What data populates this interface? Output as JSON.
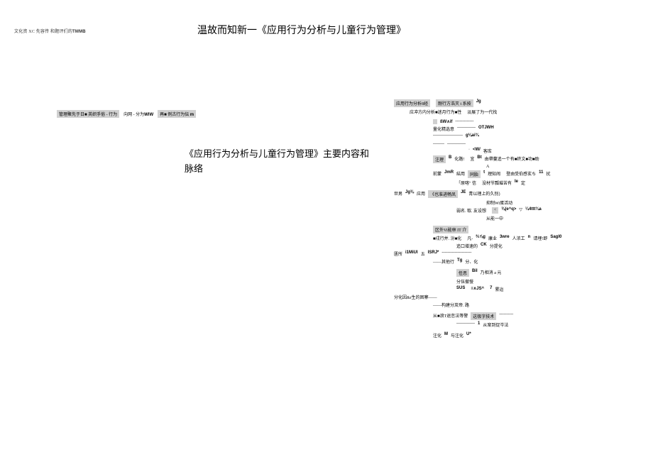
{
  "top_left_prefix": "文化资 XC 先容传 和题评们的",
  "top_left_bold": "TMMB",
  "main_title": "温故而知新一《应用行为分析与儿童行为管理》",
  "left_row": {
    "box1_a": "管理聚先于日",
    "box1_b": "■",
    "box1_c": " 英织手俗 - 行为",
    "mid": "向网 - 分为",
    "mid_bold": "WlW",
    "box2_a": "再",
    "box2_b": "■",
    "box2_c": " 例古行为伝",
    "box2_bold": "m"
  },
  "left_sub_title": "《应用行为分析与儿童行为管理》主要内容和脉络",
  "right": [
    {
      "cls": "r-line",
      "items": [
        {
          "t": "box",
          "v": "应用行为分析8经"
        },
        {
          "t": "plain",
          "v": "       "
        },
        {
          "t": "box",
          "v": "剛行方浩灭 t 系按"
        },
        {
          "t": "bold",
          "v": "Jg"
        }
      ]
    },
    {
      "cls": "r-line indent1",
      "items": [
        {
          "t": "plain",
          "v": "应冲方内分析■迷月行为■性"
        },
        {
          "t": "plain",
          "v": "                       "
        },
        {
          "t": "plain",
          "v": "淡展了为一代找"
        }
      ]
    },
    {
      "cls": "spacer"
    },
    {
      "cls": "r-line indent2",
      "items": [
        {
          "t": "box",
          "v": ""
        },
        {
          "t": "bold",
          "v": "ßW∧if"
        },
        {
          "t": "plain",
          "v": " -------------"
        }
      ]
    },
    {
      "cls": "r-line indent2",
      "items": [
        {
          "t": "plain",
          "v": "量化精选意"
        },
        {
          "t": "plain",
          "v": " -------------"
        },
        {
          "t": "bold",
          "v": "OTJWH"
        }
      ]
    },
    {
      "cls": "r-line indent2",
      "items": [
        {
          "t": "plain",
          "v": "---------------------"
        },
        {
          "t": "bold",
          "v": "g⅛ai¾"
        }
      ]
    },
    {
      "cls": "spacer"
    },
    {
      "cls": "r-line indent2",
      "items": [
        {
          "t": "plain",
          "v": "--------"
        },
        {
          "t": "plain",
          "v": "-------------"
        }
      ]
    },
    {
      "cls": "r-line indent4",
      "items": [
        {
          "t": "plain",
          "v": "·"
        },
        {
          "t": "bold",
          "v": "<W/"
        },
        {
          "t": "plain",
          "v": "客库"
        }
      ]
    },
    {
      "cls": "r-line indent2",
      "items": [
        {
          "t": "box",
          "v": "注理"
        },
        {
          "t": "bold",
          "v": "B"
        },
        {
          "t": "plain",
          "v": " 化路!"
        },
        {
          "t": "plain",
          "v": "           "
        },
        {
          "t": "plain",
          "v": "宜"
        },
        {
          "t": "bold",
          "v": "Bt"
        },
        {
          "t": "plain",
          "v": "由帶蔓追一个有■终文■功■助"
        }
      ]
    },
    {
      "cls": "r-line indent5",
      "items": [
        {
          "t": "plain",
          "v": "A"
        }
      ]
    },
    {
      "cls": "r-line indent2",
      "items": [
        {
          "t": "plain",
          "v": "前蒙"
        },
        {
          "t": "bold",
          "v": "JmR"
        },
        {
          "t": "plain",
          "v": " 結用"
        },
        {
          "t": "box",
          "v": "同胎"
        },
        {
          "t": "bold",
          "v": "t"
        },
        {
          "t": "plain",
          "v": " 理知闹"
        },
        {
          "t": "plain",
          "v": "        "
        },
        {
          "t": "plain",
          "v": "登由受伯感玄ち"
        },
        {
          "t": "bold",
          "v": "11"
        },
        {
          "t": "plain",
          "v": " 扰"
        }
      ]
    },
    {
      "cls": "r-line indent3",
      "items": [
        {
          "t": "plain",
          "v": "「原喀\" 信"
        },
        {
          "t": "plain",
          "v": "                "
        },
        {
          "t": "plain",
          "v": "没材节瓢璀苦有"
        },
        {
          "t": "bold",
          "v": "Ie"
        },
        {
          "t": "plain",
          "v": " 定"
        }
      ]
    },
    {
      "cls": "spacer"
    },
    {
      "cls": "r-line",
      "items": [
        {
          "t": "plain",
          "v": "世男"
        },
        {
          "t": "bold",
          "v": "Jg⅜"
        },
        {
          "t": "plain",
          "v": "应用"
        },
        {
          "t": "box",
          "v": "《也准进畅凤"
        },
        {
          "t": "bold",
          "v": "JE"
        },
        {
          "t": "plain",
          "v": " 青以理上的久别}"
        }
      ]
    },
    {
      "cls": "r-line indent5",
      "items": [
        {
          "t": "plain",
          "v": "抑制Wi蛋活动"
        }
      ]
    },
    {
      "cls": "r-line indent3",
      "items": [
        {
          "t": "plain",
          "v": "弱名. 取. 友设想"
        },
        {
          "t": "plain",
          "v": "    "
        },
        {
          "t": "box",
          "v": "<"
        },
        {
          "t": "bold",
          "v": "⅜(e^q>"
        },
        {
          "t": "plain",
          "v": "▽"
        },
        {
          "t": "bold",
          "v": "¼4ttt¾a"
        }
      ]
    },
    {
      "cls": "r-line indent5",
      "items": [
        {
          "t": "plain",
          "v": "从能一中"
        }
      ]
    },
    {
      "cls": "spacer"
    },
    {
      "cls": "r-line indent2",
      "items": [
        {
          "t": "box",
          "v": "区外Vi能林 IT 介"
        }
      ]
    },
    {
      "cls": "r-line indent2",
      "items": [
        {
          "t": "plain",
          "v": "■戍行并. 汾■化"
        },
        {
          "t": "plain",
          "v": "       "
        },
        {
          "t": "plain",
          "v": "凡-"
        },
        {
          "t": "bold",
          "v": "⅔⅞g"
        },
        {
          "t": "plain",
          "v": " 康业"
        },
        {
          "t": "bold",
          "v": "3wre"
        },
        {
          "t": "plain",
          "v": " 人浓工"
        },
        {
          "t": "bold",
          "v": "n"
        },
        {
          "t": "plain",
          "v": " 请埋!即"
        },
        {
          "t": "bold",
          "v": "Sagl0"
        }
      ]
    },
    {
      "cls": "r-line indent3",
      "items": [
        {
          "t": "plain",
          "v": "追口增速的"
        },
        {
          "t": "bold",
          "v": "CK"
        },
        {
          "t": "plain",
          "v": " 分提化"
        }
      ]
    },
    {
      "cls": "r-line",
      "items": [
        {
          "t": "plain",
          "v": "匱所"
        },
        {
          "t": "bold",
          "v": "i1MiUl"
        },
        {
          "t": "plain",
          "v": "五"
        },
        {
          "t": "bold",
          "v": "ISRJ*"
        },
        {
          "t": "plain",
          "v": " ---------------------"
        }
      ]
    },
    {
      "cls": "r-line indent2",
      "items": [
        {
          "t": "plain",
          "v": "——其他行"
        },
        {
          "t": "bold",
          "v": "Tg"
        },
        {
          "t": "plain",
          "v": " 分、化"
        }
      ]
    },
    {
      "cls": "spacer"
    },
    {
      "cls": "r-line indent3",
      "items": [
        {
          "t": "box",
          "v": "任恶"
        },
        {
          "t": "bold",
          "v": "Bil"
        },
        {
          "t": "plain",
          "v": " 乃相消 a 元"
        }
      ]
    },
    {
      "cls": "r-line indent3",
      "items": [
        {
          "t": "plain",
          "v": "分伍撤慢"
        }
      ]
    },
    {
      "cls": "r-line indent3",
      "items": [
        {
          "t": "bold",
          "v": "SUS"
        },
        {
          "t": "plain",
          "v": "  "
        },
        {
          "t": "bold",
          "v": "≡∧JS^"
        },
        {
          "t": "plain",
          "v": "      "
        },
        {
          "t": "bold",
          "v": "7"
        },
        {
          "t": "plain",
          "v": " 累迨"
        }
      ]
    },
    {
      "cls": "r-line",
      "items": [
        {
          "t": "plain",
          "v": "分化因&r生的困寨——"
        }
      ]
    },
    {
      "cls": "r-line indent2",
      "items": [
        {
          "t": "plain",
          "v": "——构建分岚帝. 路"
        }
      ]
    },
    {
      "cls": "spacer"
    },
    {
      "cls": "r-line indent2",
      "items": [
        {
          "t": "plain",
          "v": "从■浪T退怠法等警"
        },
        {
          "t": "box",
          "v": "这极字技术"
        },
        {
          "t": "plain",
          "v": "----------"
        }
      ]
    },
    {
      "cls": "r-line indent3",
      "items": [
        {
          "t": "plain",
          "v": "-------------"
        },
        {
          "t": "bold",
          "v": "1"
        },
        {
          "t": "plain",
          "v": " 从案到促岑法"
        }
      ]
    },
    {
      "cls": "spacer"
    },
    {
      "cls": "r-line indent2",
      "items": [
        {
          "t": "plain",
          "v": "注化"
        },
        {
          "t": "bold",
          "v": "M"
        },
        {
          "t": "plain",
          "v": " 与注化"
        },
        {
          "t": "bold",
          "v": "U*"
        }
      ]
    }
  ]
}
